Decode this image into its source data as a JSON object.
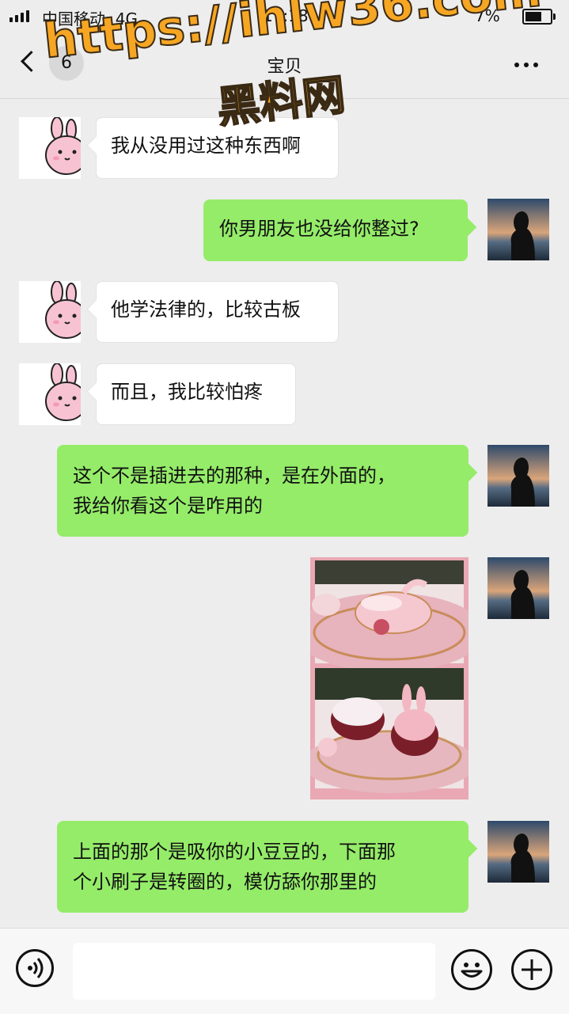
{
  "status_bar": {
    "carrier": "中国移动",
    "network": "4G",
    "time": "17:18",
    "battery_text": "7%"
  },
  "nav": {
    "unread_count": "6",
    "title": "宝贝"
  },
  "watermark": {
    "url": "https://ihlw36.com",
    "name": "黑料网"
  },
  "messages": [
    {
      "side": "left",
      "text": "我从没用过这种东西啊"
    },
    {
      "side": "right",
      "text": "你男朋友也没给你整过?"
    },
    {
      "side": "left",
      "text": "他学法律的，比较古板"
    },
    {
      "side": "left",
      "text": "而且，我比较怕疼"
    },
    {
      "side": "right",
      "line1": "这个不是插进去的那种，是在外面的，",
      "line2": "我给你看这个是咋用的"
    },
    {
      "side": "right",
      "type": "image"
    },
    {
      "side": "right",
      "line1": "上面的那个是吸你的小豆豆的，下面那",
      "line2": "个小刷子是转圈的，模仿舔你那里的"
    }
  ],
  "colors": {
    "background": "#ededed",
    "sent_bubble": "#95ec69",
    "received_bubble": "#ffffff",
    "watermark": "#f6a623"
  },
  "input_bar": {
    "value": "",
    "icons": [
      "voice-icon",
      "emoji-icon",
      "plus-icon"
    ]
  }
}
